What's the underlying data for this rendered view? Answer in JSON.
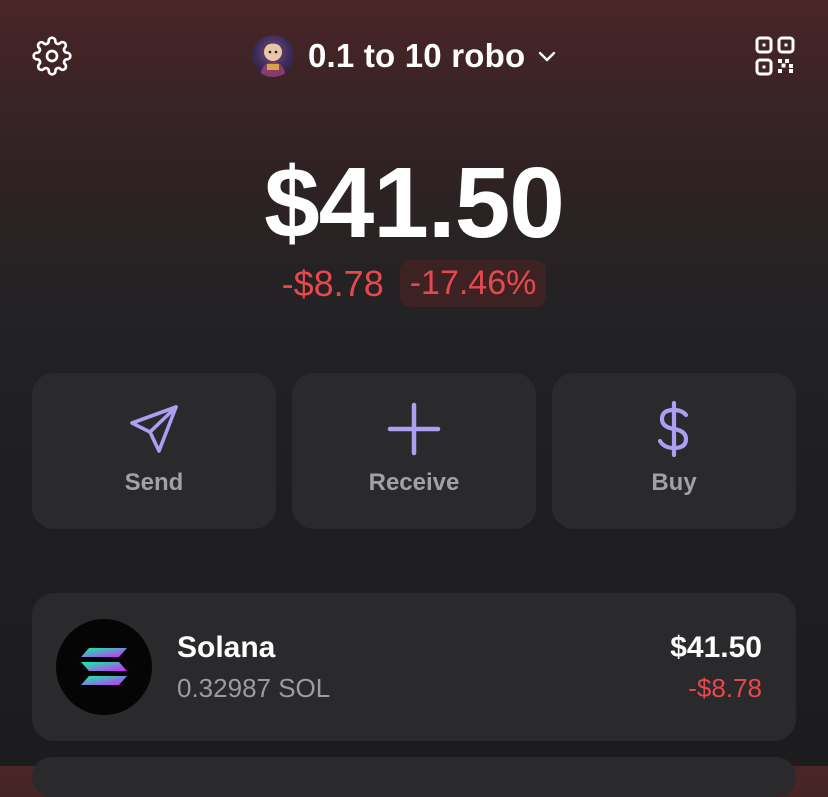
{
  "header": {
    "settings_icon": "gear-icon",
    "qr_icon": "qr-code-icon",
    "account_name": "0.1 to 10 robo",
    "account_chevron_icon": "chevron-down-icon"
  },
  "balance": {
    "total": "$41.50",
    "change_amount": "-$8.78",
    "change_percent": "-17.46%"
  },
  "actions": [
    {
      "label": "Send",
      "icon": "send-icon"
    },
    {
      "label": "Receive",
      "icon": "plus-icon"
    },
    {
      "label": "Buy",
      "icon": "dollar-icon"
    }
  ],
  "tokens": [
    {
      "name": "Solana",
      "amount": "0.32987 SOL",
      "value": "$41.50",
      "change": "-$8.78",
      "icon": "solana-logo-icon"
    }
  ],
  "colors": {
    "accent": "#ab9ff2",
    "negative": "#e5484d",
    "card": "#2a2a2d",
    "muted_text": "#a0a0a6"
  }
}
